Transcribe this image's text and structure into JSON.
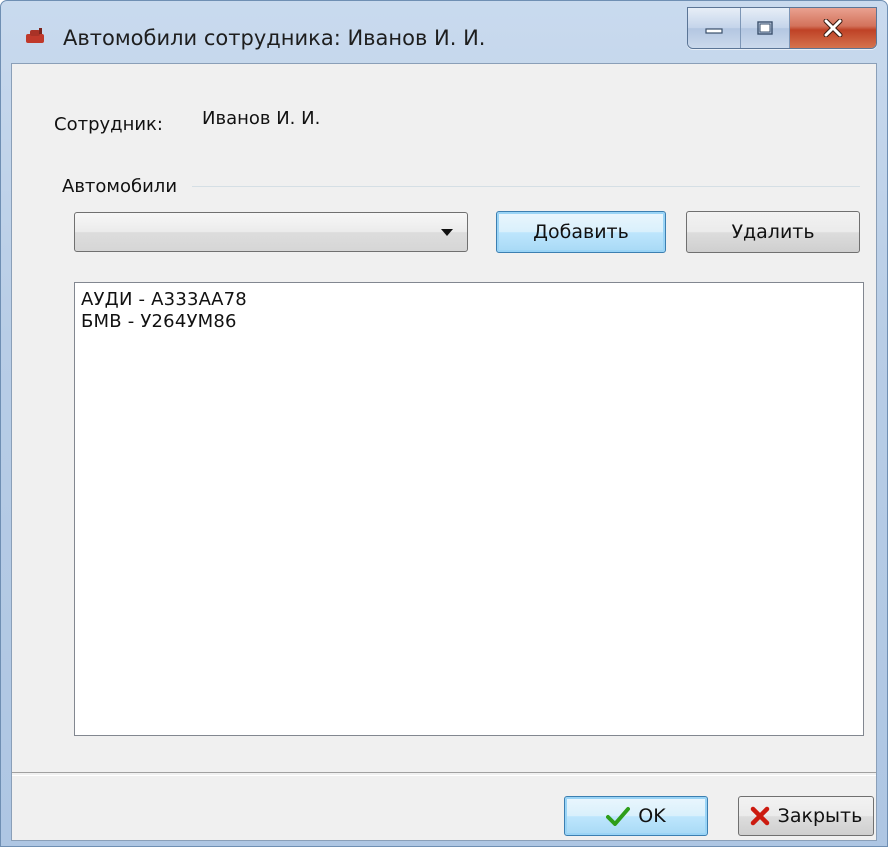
{
  "window": {
    "title": "Автомобили сотрудника: Иванов И. И.",
    "icon": "app-car-icon",
    "controls": {
      "minimize_icon": "minimize-icon",
      "maximize_icon": "maximize-icon",
      "close_icon": "close-icon"
    }
  },
  "employee": {
    "label": "Сотрудник:",
    "value": "Иванов И. И."
  },
  "cars_group": {
    "title": "Автомобили",
    "combo": {
      "value": "",
      "icon": "chevron-down-icon"
    },
    "add_label": "Добавить",
    "delete_label": "Удалить",
    "items": [
      "АУДИ - А333АА78",
      "БМВ - У264УМ86"
    ]
  },
  "footer": {
    "ok_label": "OK",
    "ok_icon": "check-icon",
    "close_label": "Закрыть",
    "close_icon": "x-icon"
  },
  "colors": {
    "titlebar": "#b8cde6",
    "client_bg": "#f0f0f0",
    "close_button": "#c7462b",
    "ok_check": "#2e9e1a",
    "close_x": "#cc1b10"
  }
}
